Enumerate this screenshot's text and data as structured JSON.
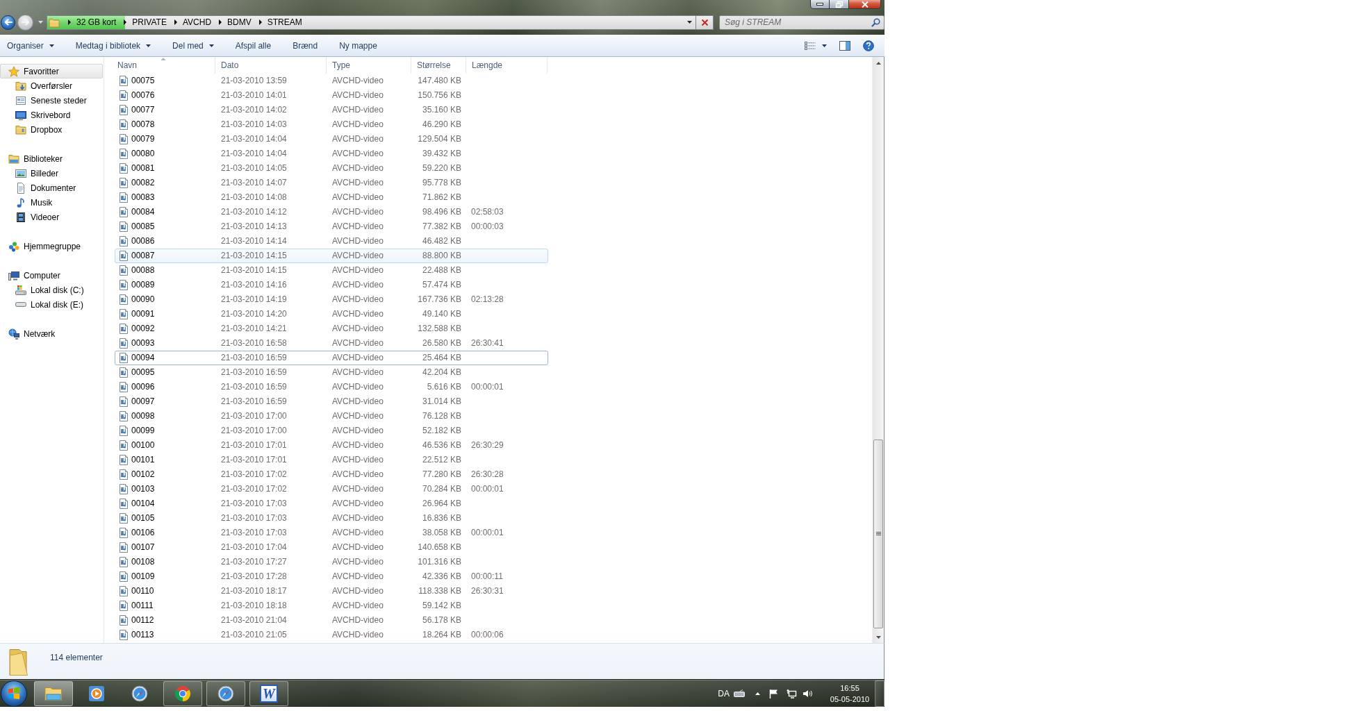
{
  "navigation": [
    {
      "kind": "back",
      "disabled": false
    },
    {
      "kind": "forward",
      "disabled": true
    }
  ],
  "address_bar": {
    "level": 0.12,
    "crumbs": [
      "32 GB kort",
      "PRIVATE",
      "AVCHD",
      "BDMV",
      "STREAM"
    ]
  },
  "search": {
    "placeholder": "Søg i STREAM"
  },
  "toolbar": [
    {
      "label": "Organiser",
      "has_menu": true
    },
    {
      "label": "Medtag i bibliotek",
      "has_menu": true
    },
    {
      "label": "Del med",
      "has_menu": true
    },
    {
      "label": "Afspil alle",
      "has_menu": false
    },
    {
      "label": "Brænd",
      "has_menu": false
    },
    {
      "label": "Ny mappe",
      "has_menu": false
    }
  ],
  "sidebar": {
    "groups": [
      {
        "label": "Favoritter",
        "selected": true,
        "children": [
          {
            "label": "Overførsler",
            "selected": false
          },
          {
            "label": "Seneste steder",
            "selected": false
          },
          {
            "label": "Skrivebord",
            "selected": false
          },
          {
            "label": "Dropbox",
            "selected": false
          }
        ]
      },
      {
        "label": "Biblioteker",
        "selected": false,
        "children": [
          {
            "label": "Billeder",
            "selected": false
          },
          {
            "label": "Dokumenter",
            "selected": false
          },
          {
            "label": "Musik",
            "selected": false
          },
          {
            "label": "Videoer",
            "selected": false
          }
        ]
      },
      {
        "label": "Hjemmegruppe",
        "selected": false
      },
      {
        "label": "Computer",
        "selected": false,
        "children": [
          {
            "label": "Lokal disk (C:)",
            "selected": false
          },
          {
            "label": "Lokal disk (E:)",
            "selected": false
          }
        ]
      },
      {
        "label": "Netværk",
        "selected": false
      }
    ]
  },
  "columns": [
    {
      "label": "Navn",
      "sorted": true
    },
    {
      "label": "Dato",
      "sorted": false
    },
    {
      "label": "Type",
      "sorted": false
    },
    {
      "label": "Størrelse",
      "sorted": false
    },
    {
      "label": "Længde",
      "sorted": false
    }
  ],
  "rows": [
    {
      "name": "00075",
      "date": "21-03-2010 13:59",
      "type": "AVCHD-video",
      "size": "147.480 KB",
      "hovered": false,
      "focused": false
    },
    {
      "name": "00076",
      "date": "21-03-2010 14:01",
      "type": "AVCHD-video",
      "size": "150.756 KB",
      "hovered": false,
      "focused": false
    },
    {
      "name": "00077",
      "date": "21-03-2010 14:02",
      "type": "AVCHD-video",
      "size": "35.160 KB",
      "hovered": false,
      "focused": false
    },
    {
      "name": "00078",
      "date": "21-03-2010 14:03",
      "type": "AVCHD-video",
      "size": "46.290 KB",
      "hovered": false,
      "focused": false
    },
    {
      "name": "00079",
      "date": "21-03-2010 14:04",
      "type": "AVCHD-video",
      "size": "129.504 KB",
      "hovered": false,
      "focused": false
    },
    {
      "name": "00080",
      "date": "21-03-2010 14:04",
      "type": "AVCHD-video",
      "size": "39.432 KB",
      "hovered": false,
      "focused": false
    },
    {
      "name": "00081",
      "date": "21-03-2010 14:05",
      "type": "AVCHD-video",
      "size": "59.220 KB",
      "hovered": false,
      "focused": false
    },
    {
      "name": "00082",
      "date": "21-03-2010 14:07",
      "type": "AVCHD-video",
      "size": "95.778 KB",
      "hovered": false,
      "focused": false
    },
    {
      "name": "00083",
      "date": "21-03-2010 14:08",
      "type": "AVCHD-video",
      "size": "71.862 KB",
      "hovered": false,
      "focused": false
    },
    {
      "name": "00084",
      "date": "21-03-2010 14:12",
      "type": "AVCHD-video",
      "size": "98.496 KB",
      "length": "02:58:03",
      "hovered": false,
      "focused": false
    },
    {
      "name": "00085",
      "date": "21-03-2010 14:13",
      "type": "AVCHD-video",
      "size": "77.382 KB",
      "length": "00:00:03",
      "hovered": false,
      "focused": false
    },
    {
      "name": "00086",
      "date": "21-03-2010 14:14",
      "type": "AVCHD-video",
      "size": "46.482 KB",
      "hovered": false,
      "focused": false
    },
    {
      "name": "00087",
      "date": "21-03-2010 14:15",
      "type": "AVCHD-video",
      "size": "88.800 KB",
      "hovered": true,
      "focused": false
    },
    {
      "name": "00088",
      "date": "21-03-2010 14:15",
      "type": "AVCHD-video",
      "size": "22.488 KB",
      "hovered": false,
      "focused": false
    },
    {
      "name": "00089",
      "date": "21-03-2010 14:16",
      "type": "AVCHD-video",
      "size": "57.474 KB",
      "hovered": false,
      "focused": false
    },
    {
      "name": "00090",
      "date": "21-03-2010 14:19",
      "type": "AVCHD-video",
      "size": "167.736 KB",
      "length": "02:13:28",
      "hovered": false,
      "focused": false
    },
    {
      "name": "00091",
      "date": "21-03-2010 14:20",
      "type": "AVCHD-video",
      "size": "49.140 KB",
      "hovered": false,
      "focused": false
    },
    {
      "name": "00092",
      "date": "21-03-2010 14:21",
      "type": "AVCHD-video",
      "size": "132.588 KB",
      "hovered": false,
      "focused": false
    },
    {
      "name": "00093",
      "date": "21-03-2010 16:58",
      "type": "AVCHD-video",
      "size": "26.580 KB",
      "length": "26:30:41",
      "hovered": false,
      "focused": false
    },
    {
      "name": "00094",
      "date": "21-03-2010 16:59",
      "type": "AVCHD-video",
      "size": "25.464 KB",
      "hovered": false,
      "focused": true
    },
    {
      "name": "00095",
      "date": "21-03-2010 16:59",
      "type": "AVCHD-video",
      "size": "42.204 KB",
      "hovered": false,
      "focused": false
    },
    {
      "name": "00096",
      "date": "21-03-2010 16:59",
      "type": "AVCHD-video",
      "size": "5.616 KB",
      "length": "00:00:01",
      "hovered": false,
      "focused": false
    },
    {
      "name": "00097",
      "date": "21-03-2010 16:59",
      "type": "AVCHD-video",
      "size": "31.014 KB",
      "hovered": false,
      "focused": false
    },
    {
      "name": "00098",
      "date": "21-03-2010 17:00",
      "type": "AVCHD-video",
      "size": "76.128 KB",
      "hovered": false,
      "focused": false
    },
    {
      "name": "00099",
      "date": "21-03-2010 17:00",
      "type": "AVCHD-video",
      "size": "52.182 KB",
      "hovered": false,
      "focused": false
    },
    {
      "name": "00100",
      "date": "21-03-2010 17:01",
      "type": "AVCHD-video",
      "size": "46.536 KB",
      "length": "26:30:29",
      "hovered": false,
      "focused": false
    },
    {
      "name": "00101",
      "date": "21-03-2010 17:01",
      "type": "AVCHD-video",
      "size": "22.512 KB",
      "hovered": false,
      "focused": false
    },
    {
      "name": "00102",
      "date": "21-03-2010 17:02",
      "type": "AVCHD-video",
      "size": "77.280 KB",
      "length": "26:30:28",
      "hovered": false,
      "focused": false
    },
    {
      "name": "00103",
      "date": "21-03-2010 17:02",
      "type": "AVCHD-video",
      "size": "70.284 KB",
      "length": "00:00:01",
      "hovered": false,
      "focused": false
    },
    {
      "name": "00104",
      "date": "21-03-2010 17:03",
      "type": "AVCHD-video",
      "size": "26.964 KB",
      "hovered": false,
      "focused": false
    },
    {
      "name": "00105",
      "date": "21-03-2010 17:03",
      "type": "AVCHD-video",
      "size": "16.836 KB",
      "hovered": false,
      "focused": false
    },
    {
      "name": "00106",
      "date": "21-03-2010 17:03",
      "type": "AVCHD-video",
      "size": "38.058 KB",
      "length": "00:00:01",
      "hovered": false,
      "focused": false
    },
    {
      "name": "00107",
      "date": "21-03-2010 17:04",
      "type": "AVCHD-video",
      "size": "140.658 KB",
      "hovered": false,
      "focused": false
    },
    {
      "name": "00108",
      "date": "21-03-2010 17:27",
      "type": "AVCHD-video",
      "size": "101.316 KB",
      "hovered": false,
      "focused": false
    },
    {
      "name": "00109",
      "date": "21-03-2010 17:28",
      "type": "AVCHD-video",
      "size": "42.336 KB",
      "length": "00:00:11",
      "hovered": false,
      "focused": false
    },
    {
      "name": "00110",
      "date": "21-03-2010 18:17",
      "type": "AVCHD-video",
      "size": "118.338 KB",
      "length": "26:30:31",
      "hovered": false,
      "focused": false
    },
    {
      "name": "00111",
      "date": "21-03-2010 18:18",
      "type": "AVCHD-video",
      "size": "59.142 KB",
      "hovered": false,
      "focused": false
    },
    {
      "name": "00112",
      "date": "21-03-2010 21:04",
      "type": "AVCHD-video",
      "size": "56.178 KB",
      "hovered": false,
      "focused": false
    },
    {
      "name": "00113",
      "date": "21-03-2010 21:05",
      "type": "AVCHD-video",
      "size": "18.264 KB",
      "length": "00:00:06",
      "hovered": false,
      "focused": false
    }
  ],
  "status_bar": {
    "count": "114 elementer"
  },
  "taskbar": {
    "apps": [
      {
        "running": true,
        "active": true
      },
      {
        "running": false,
        "active": false
      },
      {
        "running": false,
        "active": false
      },
      {
        "running": true,
        "active": false
      },
      {
        "running": true,
        "active": false
      },
      {
        "running": true,
        "active": false,
        "label": "W"
      }
    ],
    "language": "DA",
    "time": "16:55",
    "date": "05-05-2010"
  }
}
